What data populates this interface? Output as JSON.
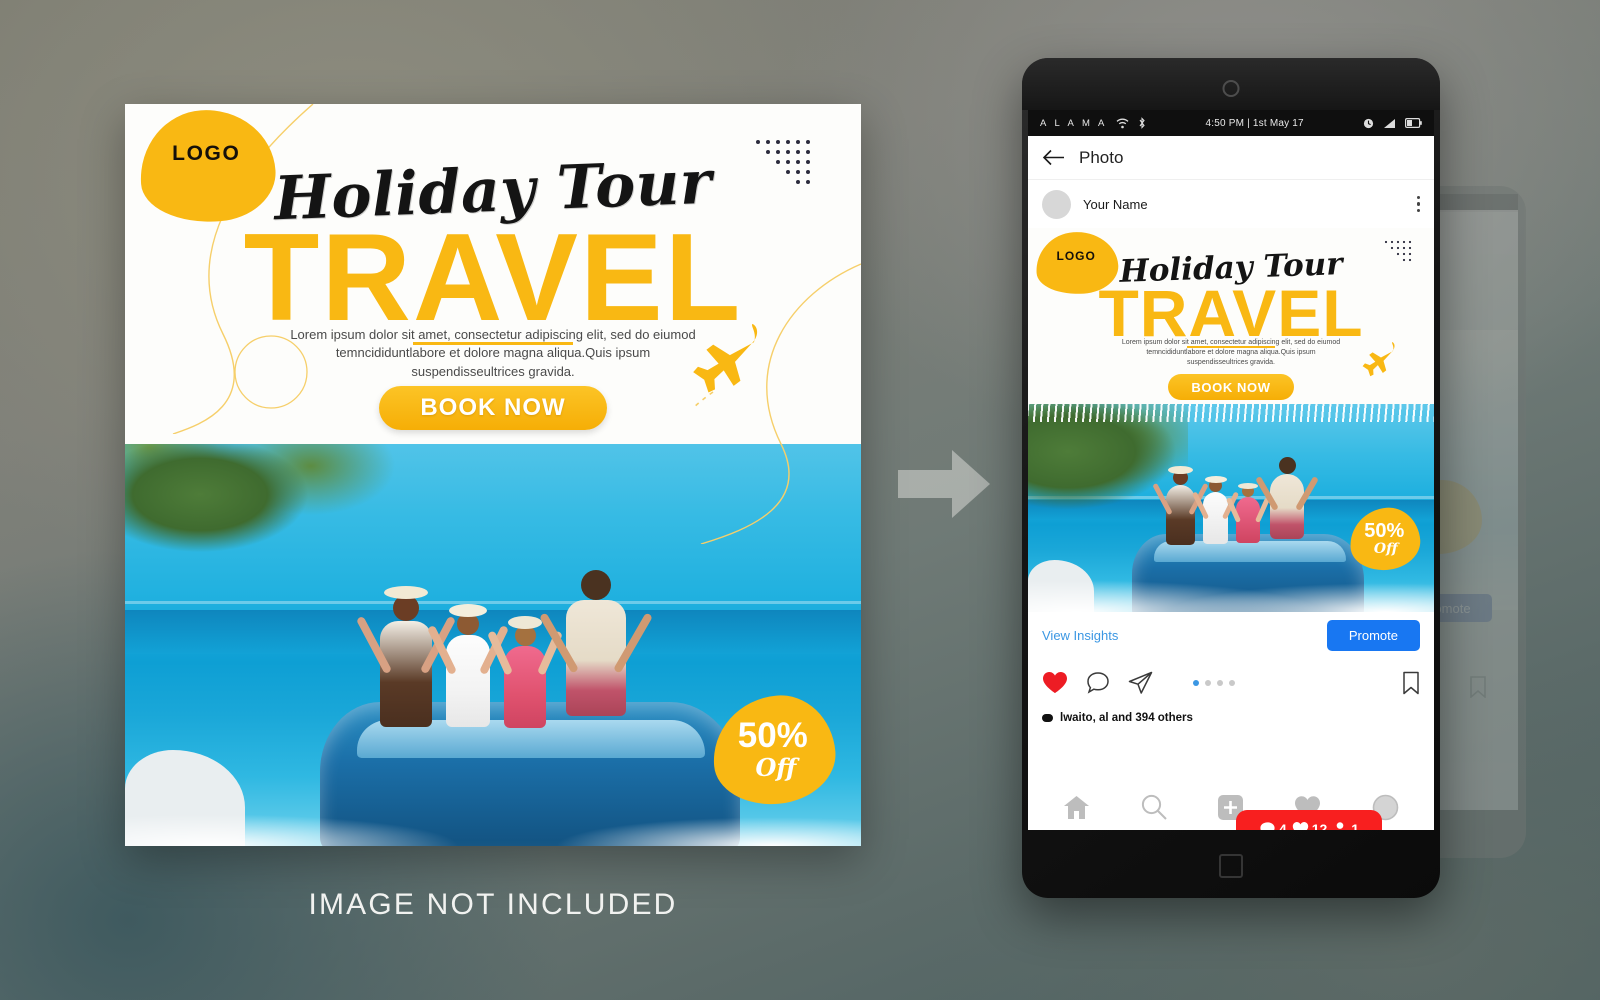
{
  "poster": {
    "logo_label": "LOGO",
    "script_title": "Holiday Tour",
    "main_title": "TRAVEL",
    "body_text": "Lorem ipsum dolor sit amet, consectetur adipiscing elit, sed do eiumod temncididuntlabore et dolore magna aliqua.Quis ipsum suspendisseultrices gravida.",
    "cta_label": "BOOK NOW",
    "discount_percent": "50%",
    "discount_off": "Off",
    "accent_color": "#f9b813",
    "sea_color": "#1fb0df"
  },
  "notice": "IMAGE NOT INCLUDED",
  "phone": {
    "statusbar": {
      "carrier": "A L A M A",
      "time": "4:50 PM | 1st May 17"
    },
    "app_header": {
      "title": "Photo"
    },
    "post": {
      "username": "Your Name"
    },
    "insights": {
      "link_label": "View Insights",
      "promote_label": "Promote",
      "promote_color": "#1877f2"
    },
    "notification": {
      "comments": "4",
      "likes": "12",
      "followers": "1",
      "color": "#f81f1f"
    },
    "likes_text": "lwaito, al  and 394 others"
  }
}
